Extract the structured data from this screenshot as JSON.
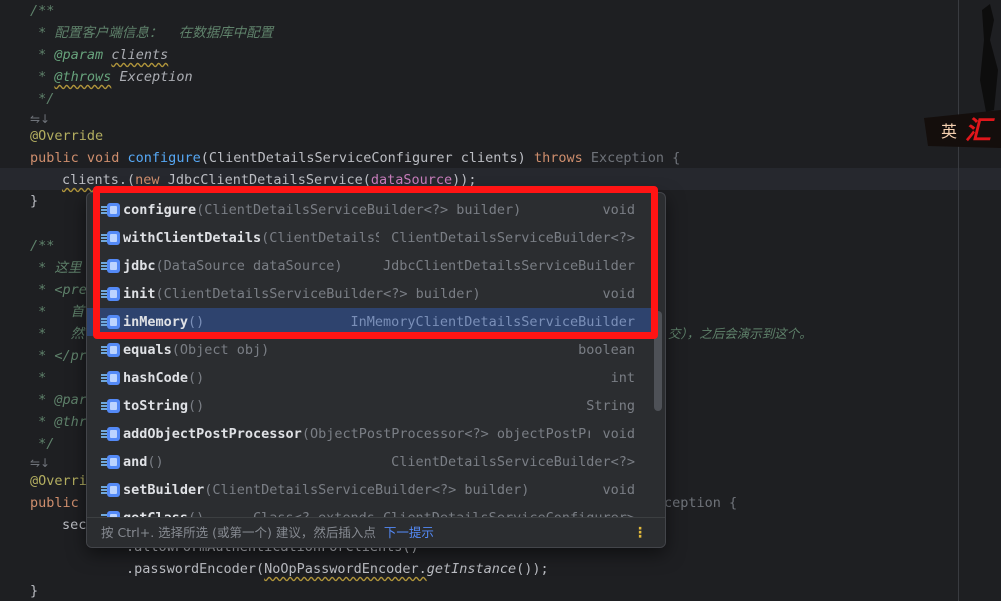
{
  "code": {
    "l1": "/**",
    "l2": " * 配置客户端信息：  在数据库中配置",
    "l3_tag": "@param",
    "l3_param": "clients",
    "l4_tag": "@throws",
    "l4_type": "Exception",
    "l5": " */",
    "l7": "@Override",
    "l8_kw": "public void ",
    "l8_fn": "configure",
    "l8_rest": "(ClientDetailsServiceConfigurer clients) ",
    "l8_throws": "throws",
    "l8_exc": " Exception {",
    "l9_a": "clients.",
    "l9_b": "(",
    "l9_new": "new ",
    "l9_c": "JdbcClientDetailsService(",
    "l9_field": "dataSource",
    "l9_d": "));",
    "l10": "}",
    "l12": "/**",
    "l13": " * 这里",
    "l14": " * <pre",
    "l15": " *   首",
    "l16": " *   然",
    "l16_tail": "交），之后会演示到这个。",
    "l17": " * </pr",
    "l18": " *",
    "l19": " * @par",
    "l20": " * @thr",
    "l21": " */",
    "l23": "@Overri",
    "l24": "public ",
    "l24_tail": "ception {",
    "l25": "sec",
    "l26": ".allowFormAuthenticationForClients()",
    "l27_a": ".passwordEncoder(",
    "l27_b": "NoOpPasswordEncoder.",
    "l27_c": "getInstance",
    "l27_d": "());",
    "l28": "}"
  },
  "logo": {
    "a": "英",
    "b": "汇"
  },
  "completion": {
    "items": [
      {
        "name": "configure",
        "params": "(ClientDetailsServiceBuilder<?> builder)",
        "ret": "void"
      },
      {
        "name": "withClientDetails",
        "params": "(ClientDetailsS…",
        "ret": "ClientDetailsServiceBuilder<?>"
      },
      {
        "name": "jdbc",
        "params": "(DataSource dataSource)",
        "ret": "JdbcClientDetailsServiceBuilder"
      },
      {
        "name": "init",
        "params": "(ClientDetailsServiceBuilder<?> builder)",
        "ret": "void"
      },
      {
        "name": "inMemory",
        "params": "()",
        "ret": "InMemoryClientDetailsServiceBuilder"
      },
      {
        "name": "equals",
        "params": "(Object obj)",
        "ret": "boolean"
      },
      {
        "name": "hashCode",
        "params": "()",
        "ret": "int"
      },
      {
        "name": "toString",
        "params": "()",
        "ret": "String"
      },
      {
        "name": "addObjectPostProcessor",
        "params": "(ObjectPostProcessor<?> objectPostPr…",
        "ret": "void"
      },
      {
        "name": "and",
        "params": "()",
        "ret": "ClientDetailsServiceBuilder<?>"
      },
      {
        "name": "setBuilder",
        "params": "(ClientDetailsServiceBuilder<?> builder)",
        "ret": "void"
      },
      {
        "name": "getClass",
        "params": "()",
        "ret": "Class<? extends ClientDetailsServiceConfigurer>"
      }
    ],
    "selected_index": 4,
    "footer_text": "按 Ctrl+. 选择所选 (或第一个) 建议，然后插入点",
    "footer_hint": "下一提示",
    "footer_more": "⋮"
  },
  "colors": {
    "accent": "#548af7",
    "highlight_box": "#ff1414",
    "selection": "#2e436e"
  }
}
